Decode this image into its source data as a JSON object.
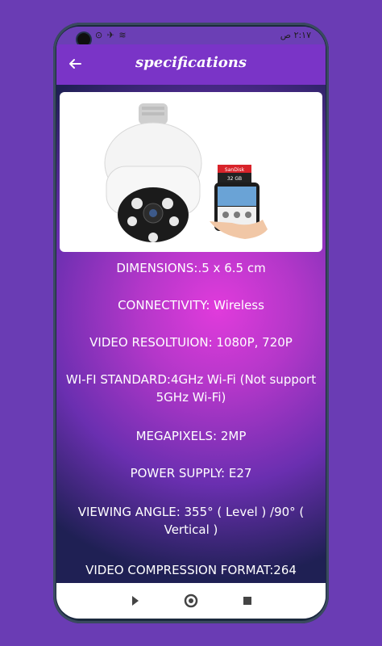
{
  "status_bar": {
    "left_icons": "⊙ ✈ ≋",
    "right_text": "٢:١٧ ص"
  },
  "appbar": {
    "title": "specifications"
  },
  "specs": [
    "DIMENSIONS:.5 x 6.5 cm",
    "CONNECTIVITY: Wireless",
    "VIDEO RESOLTUION: 1080P, 720P",
    "WI-FI STANDARD:4GHz Wi-Fi (Not support 5GHz Wi-Fi)",
    "MEGAPIXELS: 2MP",
    "POWER SUPPLY: E27",
    "VIEWING ANGLE: 355° ( Level ) /90° ( Vertical )",
    "VIDEO COMPRESSION FORMAT:264"
  ],
  "product_card": {
    "sd_card_brand": "SanDisk",
    "sd_card_capacity": "32 GB"
  },
  "icons": {
    "back": "back-arrow-icon",
    "nav_back": "triangle-back-icon",
    "nav_home": "circle-home-icon",
    "nav_recent": "square-recent-icon"
  },
  "colors": {
    "frame_bg": "#6a3cb4",
    "appbar": "#7a34c7",
    "accent_pink": "#e13bdc",
    "dark_navy": "#1f2054"
  }
}
